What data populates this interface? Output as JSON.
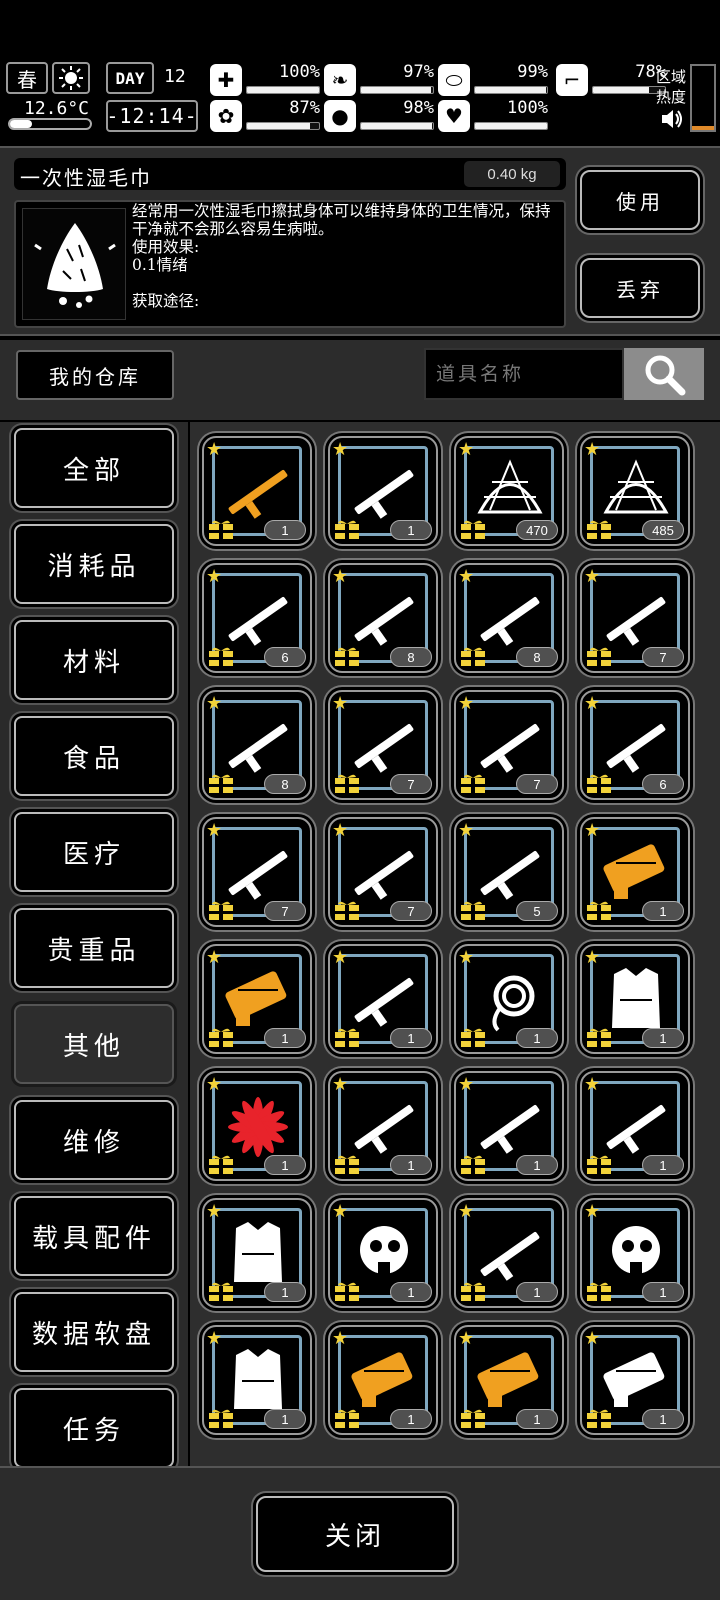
{
  "status": {
    "season": "春",
    "day_label": "DAY",
    "day_number": "12",
    "temperature": "12.6°C",
    "time": "-12:14-",
    "stats": [
      {
        "icon": "medkit-icon",
        "value": "100%",
        "level": 1.0
      },
      {
        "icon": "stomach-icon",
        "value": "97%",
        "level": 0.97
      },
      {
        "icon": "pill-icon",
        "value": "99%",
        "level": 0.99
      },
      {
        "icon": "boot-icon",
        "value": "78%",
        "level": 0.78
      },
      {
        "icon": "brain-icon",
        "value": "87%",
        "level": 0.87
      },
      {
        "icon": "water-drop-icon",
        "value": "98%",
        "level": 0.98
      },
      {
        "icon": "heart-icon",
        "value": "100%",
        "level": 1.0
      }
    ],
    "zone_label_1": "区域",
    "zone_label_2": "热度"
  },
  "detail": {
    "item_name": "一次性湿毛巾",
    "weight": "0.40 kg",
    "description": "经常用一次性湿毛巾擦拭身体可以维持身体的卫生情况，保持干净就不会那么容易生病啦。\n使用效果:\n0.1情绪\n\n获取途径:",
    "use_label": "使用",
    "discard_label": "丢弃"
  },
  "search": {
    "warehouse_label": "我的仓库",
    "placeholder": "道具名称"
  },
  "categories": [
    {
      "label": "全部",
      "active": false
    },
    {
      "label": "消耗品",
      "active": false
    },
    {
      "label": "材料",
      "active": false
    },
    {
      "label": "食品",
      "active": false
    },
    {
      "label": "医疗",
      "active": false
    },
    {
      "label": "贵重品",
      "active": false
    },
    {
      "label": "其他",
      "active": true
    },
    {
      "label": "维修",
      "active": false
    },
    {
      "label": "载具配件",
      "active": false
    },
    {
      "label": "数据软盘",
      "active": false
    },
    {
      "label": "任务",
      "active": false
    }
  ],
  "items": [
    {
      "name": "assault-rifle-gold-icon",
      "qty": "1"
    },
    {
      "name": "rocket-launcher-icon",
      "qty": "1"
    },
    {
      "name": "net-trap-icon",
      "qty": "470"
    },
    {
      "name": "net-dome-icon",
      "qty": "485"
    },
    {
      "name": "rifle-icon",
      "qty": "6"
    },
    {
      "name": "ammo-bundle-icon",
      "qty": "8"
    },
    {
      "name": "firework-rocket-icon",
      "qty": "8"
    },
    {
      "name": "sniper-rifle-icon",
      "qty": "7"
    },
    {
      "name": "shovel-icon",
      "qty": "8"
    },
    {
      "name": "axe-icon",
      "qty": "7"
    },
    {
      "name": "bow-icon",
      "qty": "7"
    },
    {
      "name": "flamethrower-icon",
      "qty": "6"
    },
    {
      "name": "carbine-icon",
      "qty": "7"
    },
    {
      "name": "spear-icon",
      "qty": "7"
    },
    {
      "name": "sword-icon",
      "qty": "5"
    },
    {
      "name": "gold-gauntlet-icon",
      "qty": "1"
    },
    {
      "name": "gold-gun-icon",
      "qty": "1"
    },
    {
      "name": "machine-gun-icon",
      "qty": "1"
    },
    {
      "name": "rope-icon",
      "qty": "1"
    },
    {
      "name": "shorts-icon",
      "qty": "1"
    },
    {
      "name": "red-flower-icon",
      "qty": "1"
    },
    {
      "name": "chain-icon",
      "qty": "1"
    },
    {
      "name": "bandana-icon",
      "qty": "1"
    },
    {
      "name": "knife-icon",
      "qty": "1"
    },
    {
      "name": "vest-icon",
      "qty": "1"
    },
    {
      "name": "gas-mask-icon",
      "qty": "1"
    },
    {
      "name": "gadget-icon",
      "qty": "1"
    },
    {
      "name": "helmet-icon",
      "qty": "1"
    },
    {
      "name": "armor-plate-icon",
      "qty": "1"
    },
    {
      "name": "gold-gauntlet-icon",
      "qty": "1"
    },
    {
      "name": "gold-blaster-icon",
      "qty": "1"
    },
    {
      "name": "cyber-gun-icon",
      "qty": "1"
    }
  ],
  "close_label": "关闭"
}
